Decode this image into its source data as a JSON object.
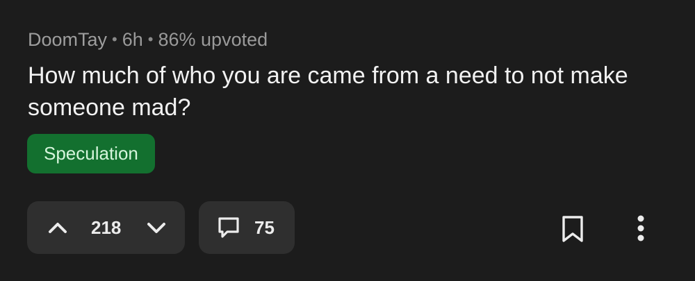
{
  "post": {
    "author": "DoomTay",
    "age": "6h",
    "upvote_ratio": "86% upvoted",
    "title": "How much of who you are came from a need to not make someone mad?",
    "flair": {
      "label": "Speculation",
      "background": "#13702f",
      "text_color": "#d6f5dc"
    }
  },
  "actions": {
    "upvote_icon": "chevron-up-icon",
    "vote_count": "218",
    "downvote_icon": "chevron-down-icon",
    "comment_icon": "comment-bubble-icon",
    "comment_count": "75",
    "save_icon": "bookmark-icon",
    "more_icon": "vertical-ellipsis-icon"
  },
  "theme": {
    "background": "#1c1c1c",
    "pill_background": "#2f2f2f",
    "meta_text": "#9a9a9a",
    "title_text": "#f2f2f2"
  }
}
